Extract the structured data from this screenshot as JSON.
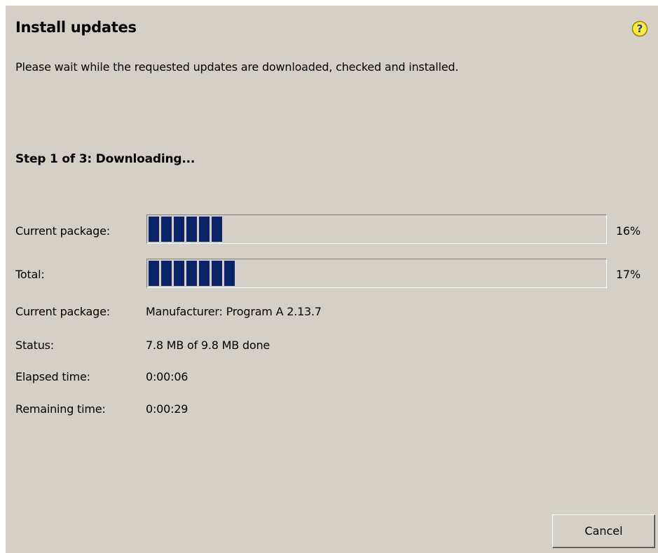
{
  "dialog": {
    "title": "Install updates",
    "subtitle": "Please wait while the requested updates are downloaded, checked and installed.",
    "help_icon": "help-question-icon"
  },
  "step": {
    "text": "Step 1 of 3: Downloading..."
  },
  "progress": {
    "current_package": {
      "label": "Current package:",
      "percent": 16,
      "percent_text": "16%"
    },
    "total": {
      "label": "Total:",
      "percent": 17,
      "percent_text": "17%"
    }
  },
  "details": {
    "package_label": "Current package:",
    "package_value": "Manufacturer: Program A  2.13.7",
    "status_label": "Status:",
    "status_value": "7.8 MB of 9.8 MB done",
    "elapsed_label": "Elapsed time:",
    "elapsed_value": "0:00:06",
    "remaining_label": "Remaining time:",
    "remaining_value": "0:00:29"
  },
  "buttons": {
    "cancel_label": "Cancel"
  },
  "colors": {
    "dialog_background": "#d4d0c8",
    "progress_fill": "#0a246a",
    "help_icon_fill": "#ffeb3b"
  }
}
